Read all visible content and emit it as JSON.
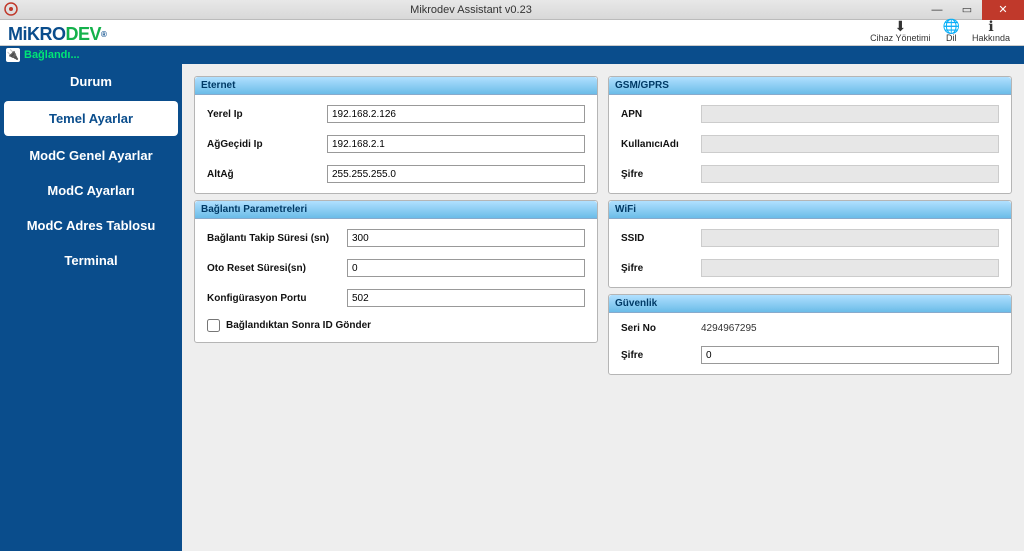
{
  "window": {
    "title": "Mikrodev Assistant v0.23"
  },
  "logo": {
    "part1": "MiKRO",
    "part2": "DEV",
    "reg": "®"
  },
  "header_buttons": {
    "device_mgmt": "Cihaz Yönetimi",
    "lang": "Dil",
    "about": "Hakkında"
  },
  "status": {
    "text": "Bağlandı..."
  },
  "sidebar": {
    "items": [
      {
        "label": "Durum"
      },
      {
        "label": "Temel Ayarlar"
      },
      {
        "label": "ModC Genel Ayarlar"
      },
      {
        "label": "ModC Ayarları"
      },
      {
        "label": "ModC Adres Tablosu"
      },
      {
        "label": "Terminal"
      }
    ],
    "active_index": 1
  },
  "panels": {
    "ethernet": {
      "title": "Eternet",
      "local_ip_label": "Yerel Ip",
      "local_ip": "192.168.2.126",
      "gateway_label": "AğGeçidi Ip",
      "gateway": "192.168.2.1",
      "subnet_label": "AltAğ",
      "subnet": "255.255.255.0"
    },
    "conn": {
      "title": "Bağlantı Parametreleri",
      "track_label": "Bağlantı Takip Süresi (sn)",
      "track": "300",
      "reset_label": "Oto Reset Süresi(sn)",
      "reset": "0",
      "config_port_label": "Konfigürasyon Portu",
      "config_port": "502",
      "send_id_label": "Bağlandıktan Sonra ID Gönder"
    },
    "gsm": {
      "title": "GSM/GPRS",
      "apn_label": "APN",
      "apn": "",
      "user_label": "KullanıcıAdı",
      "user": "",
      "pass_label": "Şifre",
      "pass": ""
    },
    "wifi": {
      "title": "WiFi",
      "ssid_label": "SSID",
      "ssid": "",
      "pass_label": "Şifre",
      "pass": ""
    },
    "security": {
      "title": "Güvenlik",
      "serial_label": "Seri No",
      "serial": "4294967295",
      "pass_label": "Şifre",
      "pass": "0"
    }
  }
}
